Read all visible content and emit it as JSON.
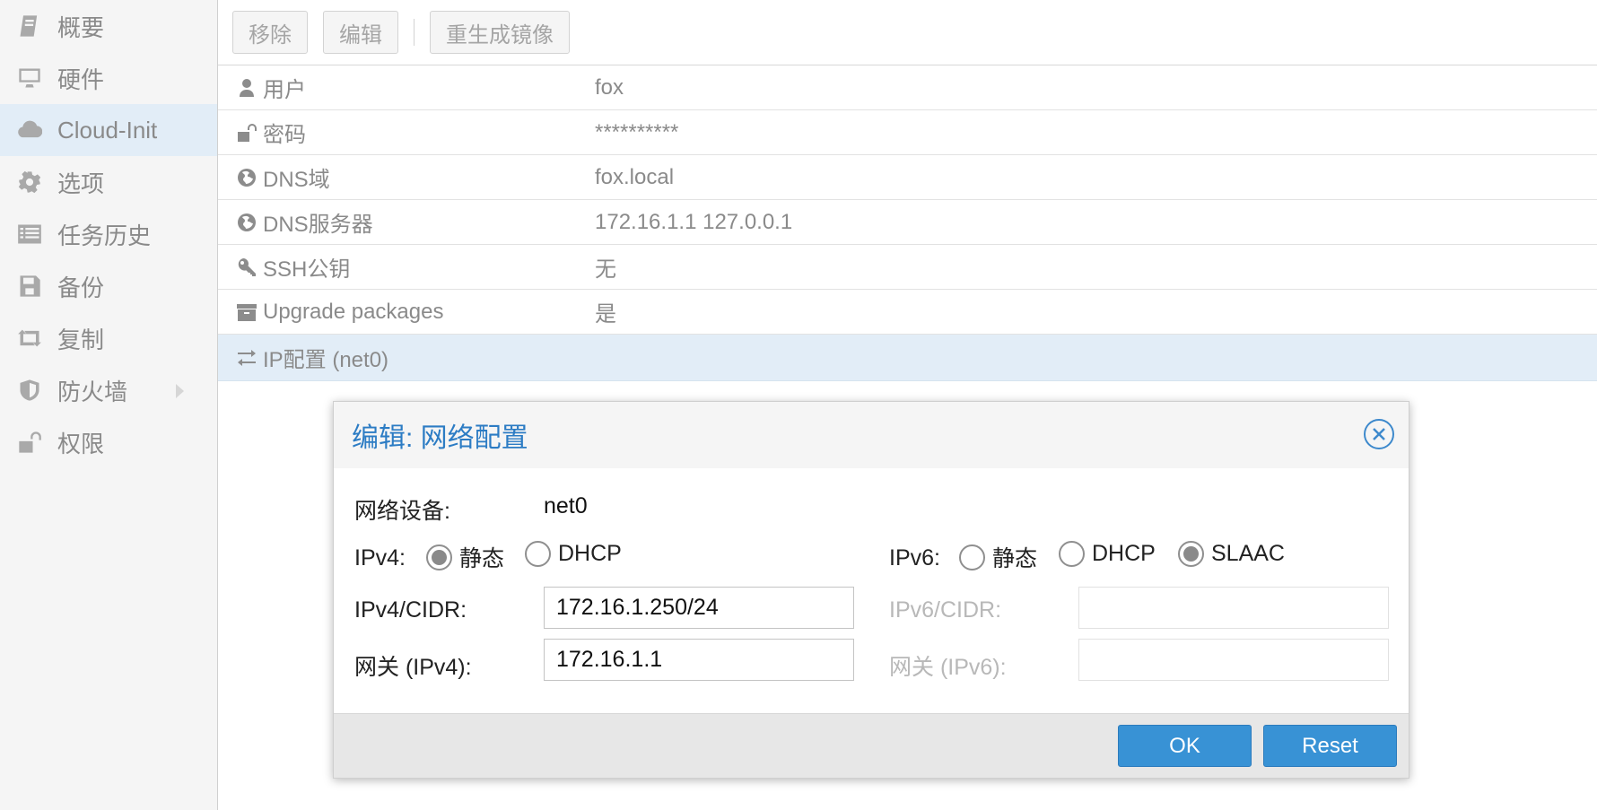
{
  "sidebar": {
    "items": [
      {
        "label": "概要",
        "icon": "book-icon"
      },
      {
        "label": "硬件",
        "icon": "desktop-icon"
      },
      {
        "label": "Cloud-Init",
        "icon": "cloud-icon",
        "active": true
      },
      {
        "label": "选项",
        "icon": "gear-icon"
      },
      {
        "label": "任务历史",
        "icon": "list-icon"
      },
      {
        "label": "备份",
        "icon": "floppy-icon"
      },
      {
        "label": "复制",
        "icon": "retweet-icon"
      },
      {
        "label": "防火墙",
        "icon": "shield-icon",
        "expandable": true
      },
      {
        "label": "权限",
        "icon": "unlock-icon"
      }
    ]
  },
  "toolbar": {
    "remove_label": "移除",
    "edit_label": "编辑",
    "regenerate_label": "重生成镜像"
  },
  "properties": [
    {
      "key": "用户",
      "value": "fox",
      "icon": "user-icon"
    },
    {
      "key": "密码",
      "value": "**********",
      "icon": "unlock-icon"
    },
    {
      "key": "DNS域",
      "value": "fox.local",
      "icon": "globe-icon"
    },
    {
      "key": "DNS服务器",
      "value": "172.16.1.1 127.0.0.1",
      "icon": "globe-icon"
    },
    {
      "key": "SSH公钥",
      "value": "无",
      "icon": "key-icon"
    },
    {
      "key": "Upgrade packages",
      "value": "是",
      "icon": "archive-icon"
    },
    {
      "key": "IP配置 (net0)",
      "value": "",
      "icon": "exchange-icon",
      "selected": true
    }
  ],
  "dialog": {
    "title": "编辑: 网络配置",
    "device_label": "网络设备:",
    "device_value": "net0",
    "ipv4_label": "IPv4:",
    "ipv4_options": [
      "静态",
      "DHCP"
    ],
    "ipv4_selected": "静态",
    "ipv6_label": "IPv6:",
    "ipv6_options": [
      "静态",
      "DHCP",
      "SLAAC"
    ],
    "ipv6_selected": "SLAAC",
    "ipv4_cidr_label": "IPv4/CIDR:",
    "ipv4_cidr_value": "172.16.1.250/24",
    "gateway4_label": "网关 (IPv4):",
    "gateway4_value": "172.16.1.1",
    "ipv6_cidr_label": "IPv6/CIDR:",
    "ipv6_cidr_value": "",
    "gateway6_label": "网关 (IPv6):",
    "gateway6_value": "",
    "ok_label": "OK",
    "reset_label": "Reset"
  },
  "colors": {
    "accent": "#3892d5",
    "title": "#2c7cc4",
    "selection": "#e2edf7"
  }
}
